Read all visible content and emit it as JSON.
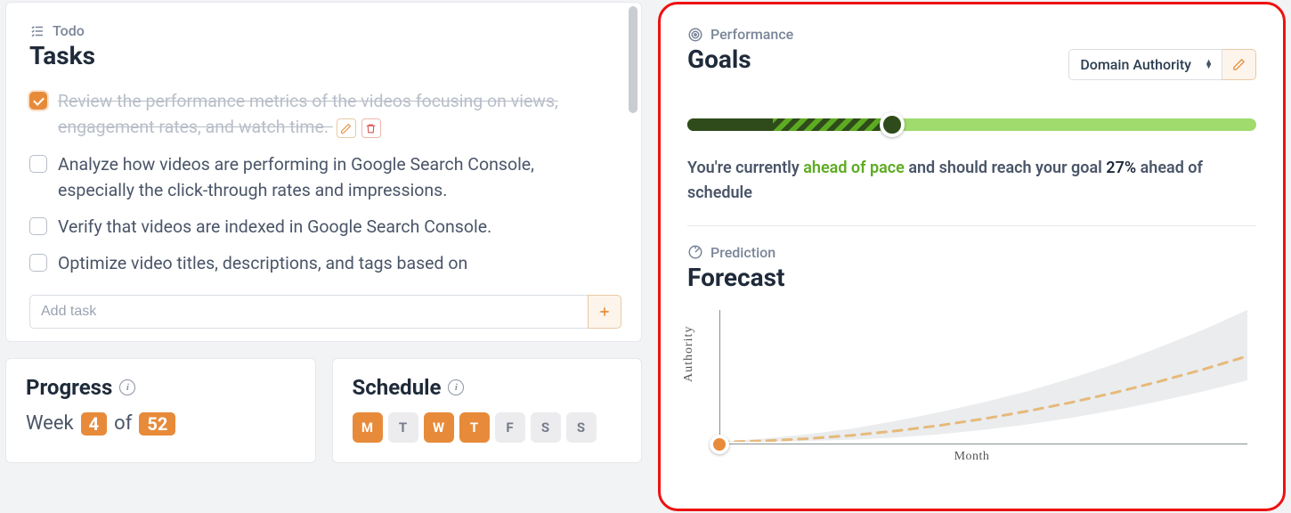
{
  "tasks_panel": {
    "eyebrow": "Todo",
    "title": "Tasks",
    "items": [
      {
        "text": "Review the performance metrics of the videos focusing on views, engagement rates, and watch time.",
        "done": true
      },
      {
        "text": "Analyze how videos are performing in Google Search Console, especially the click-through rates and impressions.",
        "done": false
      },
      {
        "text": "Verify that videos are indexed in Google Search Console.",
        "done": false
      },
      {
        "text": "Optimize video titles, descriptions, and tags based on",
        "done": false
      }
    ],
    "add_placeholder": "Add task"
  },
  "progress_panel": {
    "title": "Progress",
    "week_label": "Week",
    "week_current": "4",
    "week_of": "of",
    "week_total": "52"
  },
  "schedule_panel": {
    "title": "Schedule",
    "days": [
      {
        "letter": "M",
        "active": true
      },
      {
        "letter": "T",
        "active": false
      },
      {
        "letter": "W",
        "active": true
      },
      {
        "letter": "T",
        "active": true
      },
      {
        "letter": "F",
        "active": false
      },
      {
        "letter": "S",
        "active": false
      },
      {
        "letter": "S",
        "active": false
      }
    ]
  },
  "goals_panel": {
    "eyebrow": "Performance",
    "title": "Goals",
    "metric_selected": "Domain Authority",
    "pace_prefix": "You're currently ",
    "pace_status": "ahead of pace",
    "pace_mid": " and should reach your goal ",
    "pace_pct": "27%",
    "pace_suffix": " ahead of schedule",
    "progress": {
      "completed": 15,
      "projected": 36
    }
  },
  "forecast_panel": {
    "eyebrow": "Prediction",
    "title": "Forecast",
    "ylabel": "Authority",
    "xlabel": "Month"
  },
  "chart_data": {
    "type": "line",
    "title": "Forecast",
    "xlabel": "Month",
    "ylabel": "Authority",
    "x": [
      0,
      1,
      2,
      3,
      4,
      5,
      6,
      7,
      8,
      9,
      10,
      11,
      12
    ],
    "series": [
      {
        "name": "forecast_mean",
        "values": [
          0,
          1,
          3,
          6,
          10,
          15,
          21,
          28,
          36,
          45,
          55,
          66,
          78
        ]
      },
      {
        "name": "forecast_upper",
        "values": [
          0,
          3,
          7,
          12,
          19,
          27,
          36,
          46,
          58,
          71,
          86,
          102,
          120
        ]
      },
      {
        "name": "forecast_lower",
        "values": [
          0,
          0,
          1,
          2,
          4,
          7,
          11,
          16,
          22,
          29,
          37,
          46,
          56
        ]
      }
    ],
    "current_point": {
      "x": 0,
      "y": 0
    },
    "xlim": [
      0,
      12
    ],
    "ylim": [
      0,
      120
    ]
  }
}
